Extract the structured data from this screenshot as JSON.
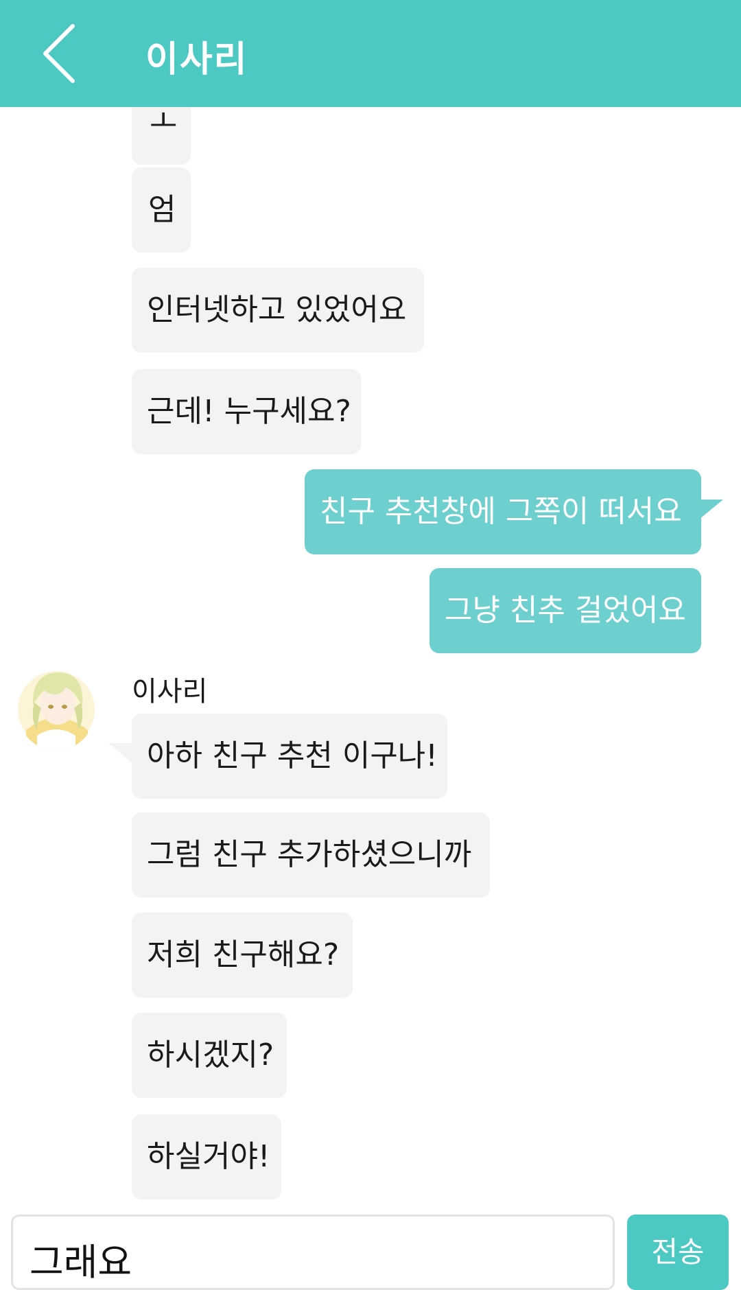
{
  "header": {
    "back_icon": "chevron-left-icon",
    "title": "이사리"
  },
  "colors": {
    "accent": "#4cc9c3",
    "outgoing_bubble": "#6dd0cf",
    "incoming_bubble": "#f3f3f3"
  },
  "messages": [
    {
      "from": "them",
      "text": "ㅗ"
    },
    {
      "from": "them",
      "text": "엄"
    },
    {
      "from": "them",
      "text": "인터넷하고 있었어요"
    },
    {
      "from": "them",
      "text": "근데! 누구세요?"
    },
    {
      "from": "me",
      "text": "친구 추천창에 그쪽이 떠서요"
    },
    {
      "from": "me",
      "text": "그냥 친추 걸었어요"
    },
    {
      "from": "them",
      "text": "아하 친구 추천 이구나!"
    },
    {
      "from": "them",
      "text": "그럼 친구 추가하셨으니까"
    },
    {
      "from": "them",
      "text": "저희 친구해요?"
    },
    {
      "from": "them",
      "text": "하시겠지?"
    },
    {
      "from": "them",
      "text": "하실거야!"
    }
  ],
  "sender": {
    "name": "이사리",
    "avatar_icon": "avatar-illustration"
  },
  "composer": {
    "value": "그래요",
    "send_label": "전송"
  }
}
